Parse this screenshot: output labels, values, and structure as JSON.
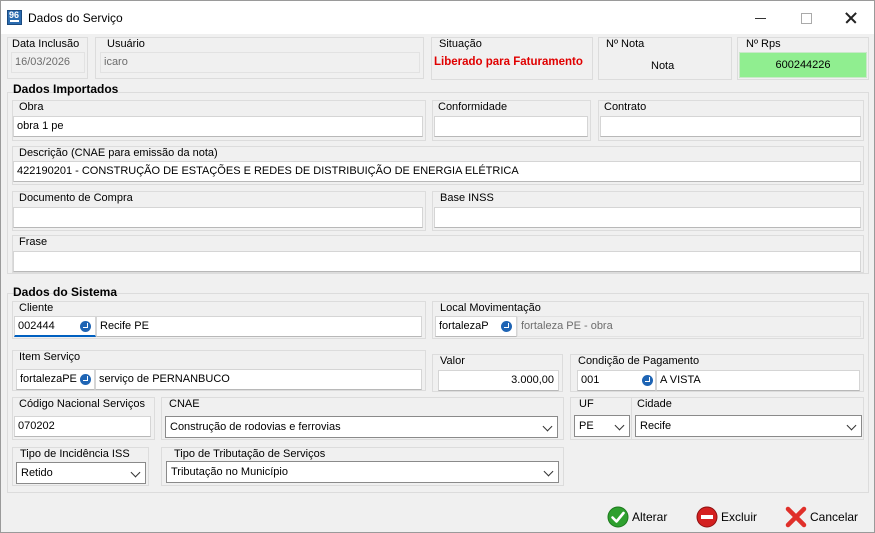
{
  "window": {
    "title": "Dados do Serviço",
    "icon_text": "96"
  },
  "top": {
    "data_inclusao": {
      "label": "Data Inclusão",
      "value": "16/03/2026"
    },
    "usuario": {
      "label": "Usuário",
      "value": "icaro"
    },
    "situacao": {
      "label": "Situação",
      "value": "Liberado para Faturamento",
      "color": "#e00000"
    },
    "nota": {
      "label": "Nº Nota",
      "value": "Nota"
    },
    "rps": {
      "label": "Nº Rps",
      "value": "600244226",
      "color": "#90ee90"
    }
  },
  "importados": {
    "header": "Dados Importados",
    "obra": {
      "label": "Obra",
      "value": "obra 1 pe"
    },
    "conformidade": {
      "label": "Conformidade",
      "value": ""
    },
    "contrato": {
      "label": "Contrato",
      "value": ""
    },
    "descricao": {
      "label": "Descrição (CNAE para emissão da nota)",
      "value": "422190201 - CONSTRUÇÃO DE ESTAÇÕES E REDES DE DISTRIBUIÇÃO DE ENERGIA ELÉTRICA"
    },
    "documento_compra": {
      "label": "Documento de Compra",
      "value": ""
    },
    "base_inss": {
      "label": "Base INSS",
      "value": ""
    },
    "frase": {
      "label": "Frase",
      "value": ""
    }
  },
  "sistema": {
    "header": "Dados do Sistema",
    "cliente": {
      "label": "Cliente",
      "code": "002444",
      "name": "Recife PE"
    },
    "local": {
      "label": "Local Movimentação",
      "code": "fortalezaP",
      "name": "fortaleza PE - obra"
    },
    "item_servico": {
      "label": "Item Serviço",
      "code": "fortalezaPE",
      "name": "serviço de PERNANBUCO"
    },
    "valor": {
      "label": "Valor",
      "value": "3.000,00"
    },
    "condicao": {
      "label": "Condição de Pagamento",
      "code": "001",
      "name": "A VISTA"
    },
    "codigo_nacional": {
      "label": "Código Nacional Serviços",
      "value": "070202"
    },
    "cnae": {
      "label": "CNAE",
      "value": "Construção de rodovias e ferrovias"
    },
    "uf": {
      "label": "UF",
      "value": "PE"
    },
    "cidade": {
      "label": "Cidade",
      "value": "Recife"
    },
    "incidencia": {
      "label": "Tipo de Incidência ISS",
      "value": "Retido"
    },
    "tributacao": {
      "label": "Tipo de Tributação de Serviços",
      "value": "Tributação no Município"
    }
  },
  "buttons": {
    "alterar": "Alterar",
    "excluir": "Excluir",
    "cancelar": "Cancelar"
  },
  "colors": {
    "accent": "#0060c0",
    "ok_green": "#2ea02e",
    "excluir_red": "#d42020",
    "cancel_red": "#e0302a"
  }
}
